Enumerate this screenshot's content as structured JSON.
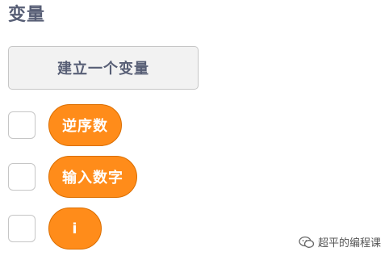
{
  "section": {
    "title": "变量"
  },
  "make_variable_button": {
    "label": "建立一个变量"
  },
  "variables": [
    {
      "label": "逆序数"
    },
    {
      "label": "输入数字"
    },
    {
      "label": "i"
    }
  ],
  "watermark": {
    "text": "超平的编程课"
  },
  "colors": {
    "variable_block_fill": "#ff8c1a",
    "variable_block_border": "#db6e00",
    "section_title": "#575e75",
    "button_bg": "#f2f2f2"
  }
}
